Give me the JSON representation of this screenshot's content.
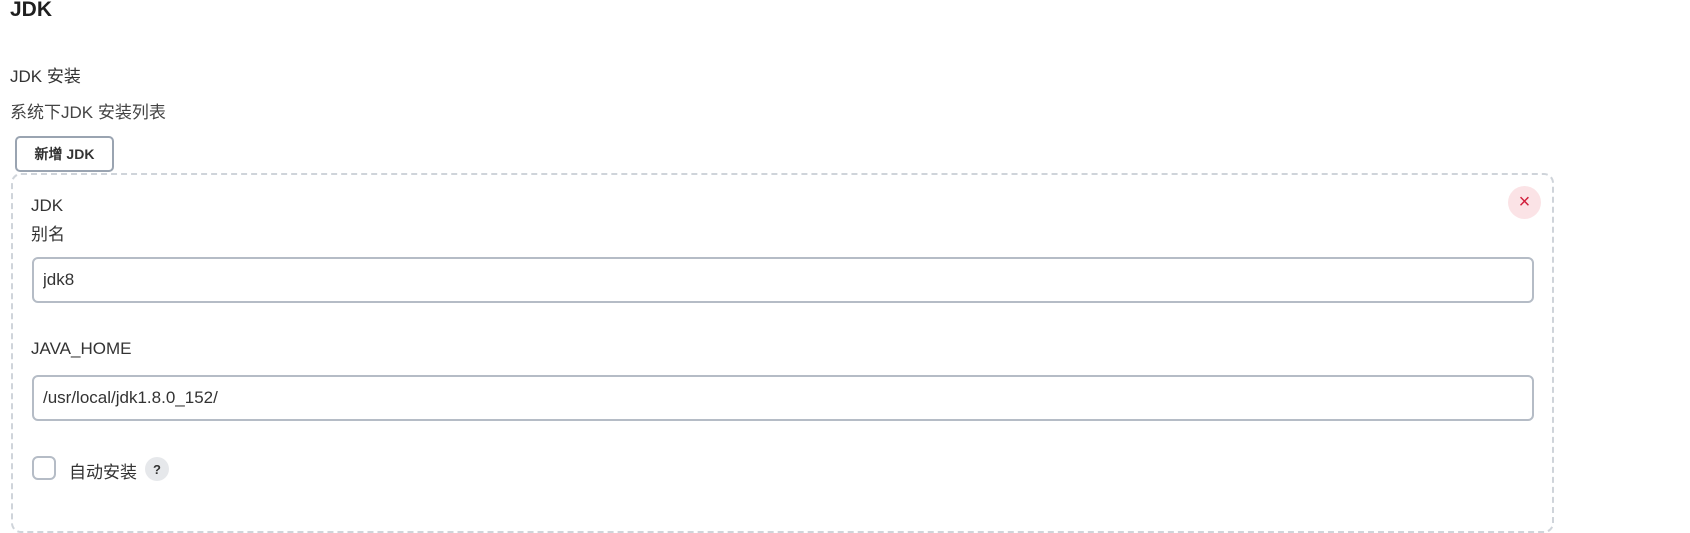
{
  "section": {
    "title": "JDK",
    "install_label": "JDK 安装",
    "description": "系统下JDK 安装列表",
    "add_button_label": "新增 JDK"
  },
  "jdk_entry": {
    "type_label": "JDK",
    "alias_label": "别名",
    "alias_value": "jdk8",
    "java_home_label": "JAVA_HOME",
    "java_home_value": "/usr/local/jdk1.8.0_152/",
    "auto_install_label": "自动安装",
    "auto_install_checked": false,
    "close_symbol": "×",
    "help_symbol": "?"
  },
  "colors": {
    "close_accent": "#d11f3c",
    "close_bg": "#fbe3e6"
  }
}
